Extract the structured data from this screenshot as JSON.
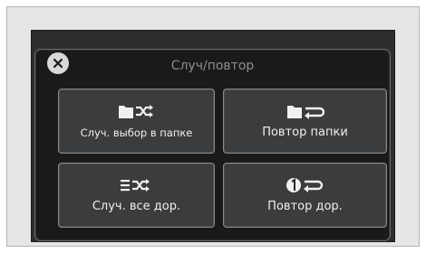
{
  "dialog": {
    "title": "Случ/повтор",
    "close_icon": "close-icon"
  },
  "tiles": [
    {
      "label": "Случ. выбор в папке",
      "icon": "folder-shuffle-icon"
    },
    {
      "label": "Повтор папки",
      "icon": "folder-repeat-icon"
    },
    {
      "label": "Случ. все дор.",
      "icon": "shuffle-all-icon"
    },
    {
      "label": "Повтор дор.",
      "icon": "repeat-one-icon"
    }
  ],
  "colors": {
    "screen_bg": "#1a1a1a",
    "tile_bg": "#3a3c3e",
    "text": "#f0f0f0",
    "title_text": "#8e8e8e"
  }
}
